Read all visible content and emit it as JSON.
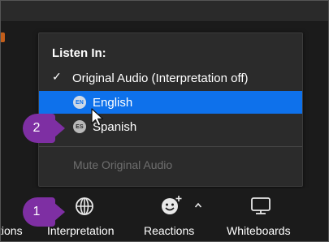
{
  "interpretation_menu": {
    "header": "Listen In:",
    "items": [
      {
        "label": "Original Audio (Interpretation off)",
        "checked": true
      },
      {
        "label": "English",
        "badge": "EN",
        "highlighted": true
      },
      {
        "label": "Spanish",
        "badge": "ES",
        "highlighted": false
      }
    ],
    "mute_label": "Mute Original Audio"
  },
  "toolbar": {
    "partial_label": "tions",
    "interpretation_label": "Interpretation",
    "reactions_label": "Reactions",
    "whiteboards_label": "Whiteboards",
    "icons": [
      "globe-icon",
      "emoji-plus-icon",
      "chevron-up-icon",
      "whiteboard-icon"
    ]
  },
  "step_badges": [
    "1",
    "2"
  ],
  "colors": {
    "highlight": "#0e71eb",
    "panel": "#2b2b2b",
    "step_badge": "#7e2fa3",
    "disabled_text": "#6e6e6e"
  }
}
